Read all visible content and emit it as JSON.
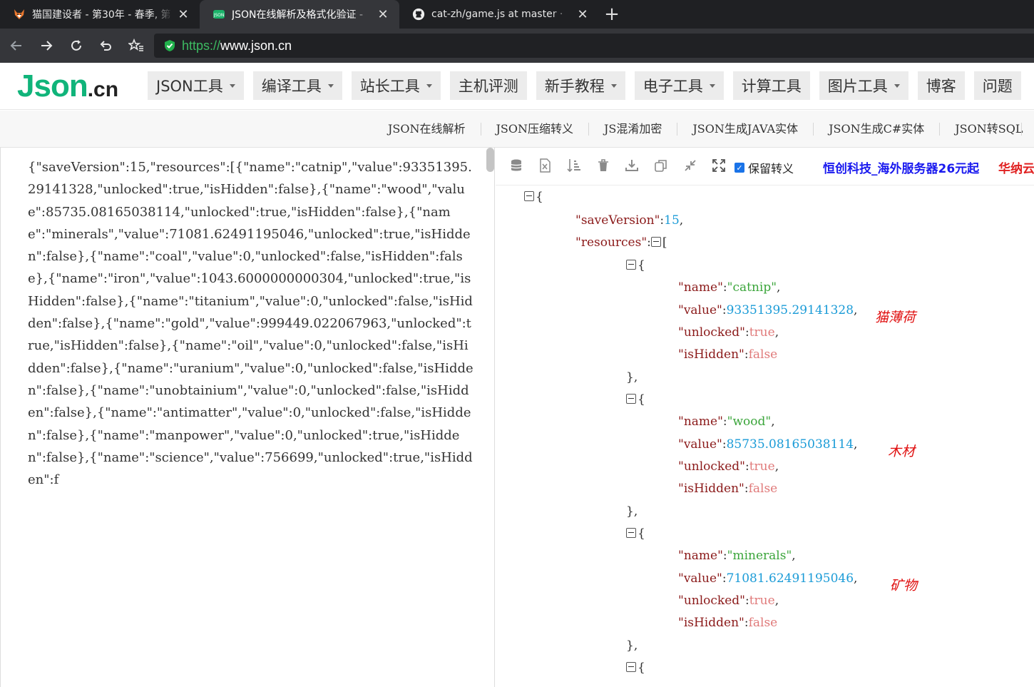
{
  "browser": {
    "tabs": [
      {
        "title": "猫国建设者 - 第30年 - 春季, 第",
        "icon": "fox-icon",
        "active": false
      },
      {
        "title": "JSON在线解析及格式化验证 -",
        "icon": "json-icon",
        "active": true
      },
      {
        "title": "cat-zh/game.js at master · ",
        "icon": "github-icon",
        "active": false
      }
    ],
    "new_tab": "+",
    "close_glyph": "✕",
    "url_scheme": "https://",
    "url_host": "www.json.cn"
  },
  "site": {
    "logo_main": "Json",
    "logo_tld": ".cn",
    "nav": [
      {
        "label": "JSON工具",
        "dropdown": true
      },
      {
        "label": "编译工具",
        "dropdown": true
      },
      {
        "label": "站长工具",
        "dropdown": true
      },
      {
        "label": "主机评测",
        "dropdown": false
      },
      {
        "label": "新手教程",
        "dropdown": true
      },
      {
        "label": "电子工具",
        "dropdown": true
      },
      {
        "label": "计算工具",
        "dropdown": false
      },
      {
        "label": "图片工具",
        "dropdown": true
      },
      {
        "label": "博客",
        "dropdown": false
      },
      {
        "label": "问题",
        "dropdown": false
      }
    ],
    "subnav": [
      "JSON在线解析",
      "JSON压缩转义",
      "JS混淆加密",
      "JSON生成JAVA实体",
      "JSON生成C#实体",
      "JSON转SQL"
    ]
  },
  "editor": {
    "raw_text": "{\"saveVersion\":15,\"resources\":[{\"name\":\"catnip\",\"value\":93351395.29141328,\"unlocked\":true,\"isHidden\":false},{\"name\":\"wood\",\"value\":85735.08165038114,\"unlocked\":true,\"isHidden\":false},{\"name\":\"minerals\",\"value\":71081.62491195046,\"unlocked\":true,\"isHidden\":false},{\"name\":\"coal\",\"value\":0,\"unlocked\":false,\"isHidden\":false},{\"name\":\"iron\",\"value\":1043.6000000000304,\"unlocked\":true,\"isHidden\":false},{\"name\":\"titanium\",\"value\":0,\"unlocked\":false,\"isHidden\":false},{\"name\":\"gold\",\"value\":999449.022067963,\"unlocked\":true,\"isHidden\":false},{\"name\":\"oil\",\"value\":0,\"unlocked\":false,\"isHidden\":false},{\"name\":\"uranium\",\"value\":0,\"unlocked\":false,\"isHidden\":false},{\"name\":\"unobtainium\",\"value\":0,\"unlocked\":false,\"isHidden\":false},{\"name\":\"antimatter\",\"value\":0,\"unlocked\":false,\"isHidden\":false},{\"name\":\"manpower\",\"value\":0,\"unlocked\":true,\"isHidden\":false},{\"name\":\"science\",\"value\":756699,\"unlocked\":true,\"isHidden\":f"
  },
  "viewer": {
    "toolbar_icons": [
      "database-icon",
      "excel-icon",
      "sort-icon",
      "trash-icon",
      "download-icon",
      "copy-icon",
      "compress-icon",
      "expand-icon"
    ],
    "keep_escape_label": "保留转义",
    "keep_escape_checked": true,
    "ad_text_1": "恒创科技_海外服务器26元起",
    "ad_text_2": "华纳云",
    "root_open": "{",
    "save_version_key": "\"saveVersion\"",
    "save_version_value": "15",
    "resources_key": "\"resources\"",
    "array_open": "[",
    "items": [
      {
        "name": "\"catnip\"",
        "value": "93351395.29141328",
        "unlocked": "true",
        "isHidden": "false",
        "annotation": "猫薄荷"
      },
      {
        "name": "\"wood\"",
        "value": "85735.08165038114",
        "unlocked": "true",
        "isHidden": "false",
        "annotation": "木材"
      },
      {
        "name": "\"minerals\"",
        "value": "71081.62491195046",
        "unlocked": "true",
        "isHidden": "false",
        "annotation": "矿物"
      }
    ],
    "key_name": "\"name\"",
    "key_value": "\"value\"",
    "key_unlocked": "\"unlocked\"",
    "key_hidden": "\"isHidden\""
  }
}
